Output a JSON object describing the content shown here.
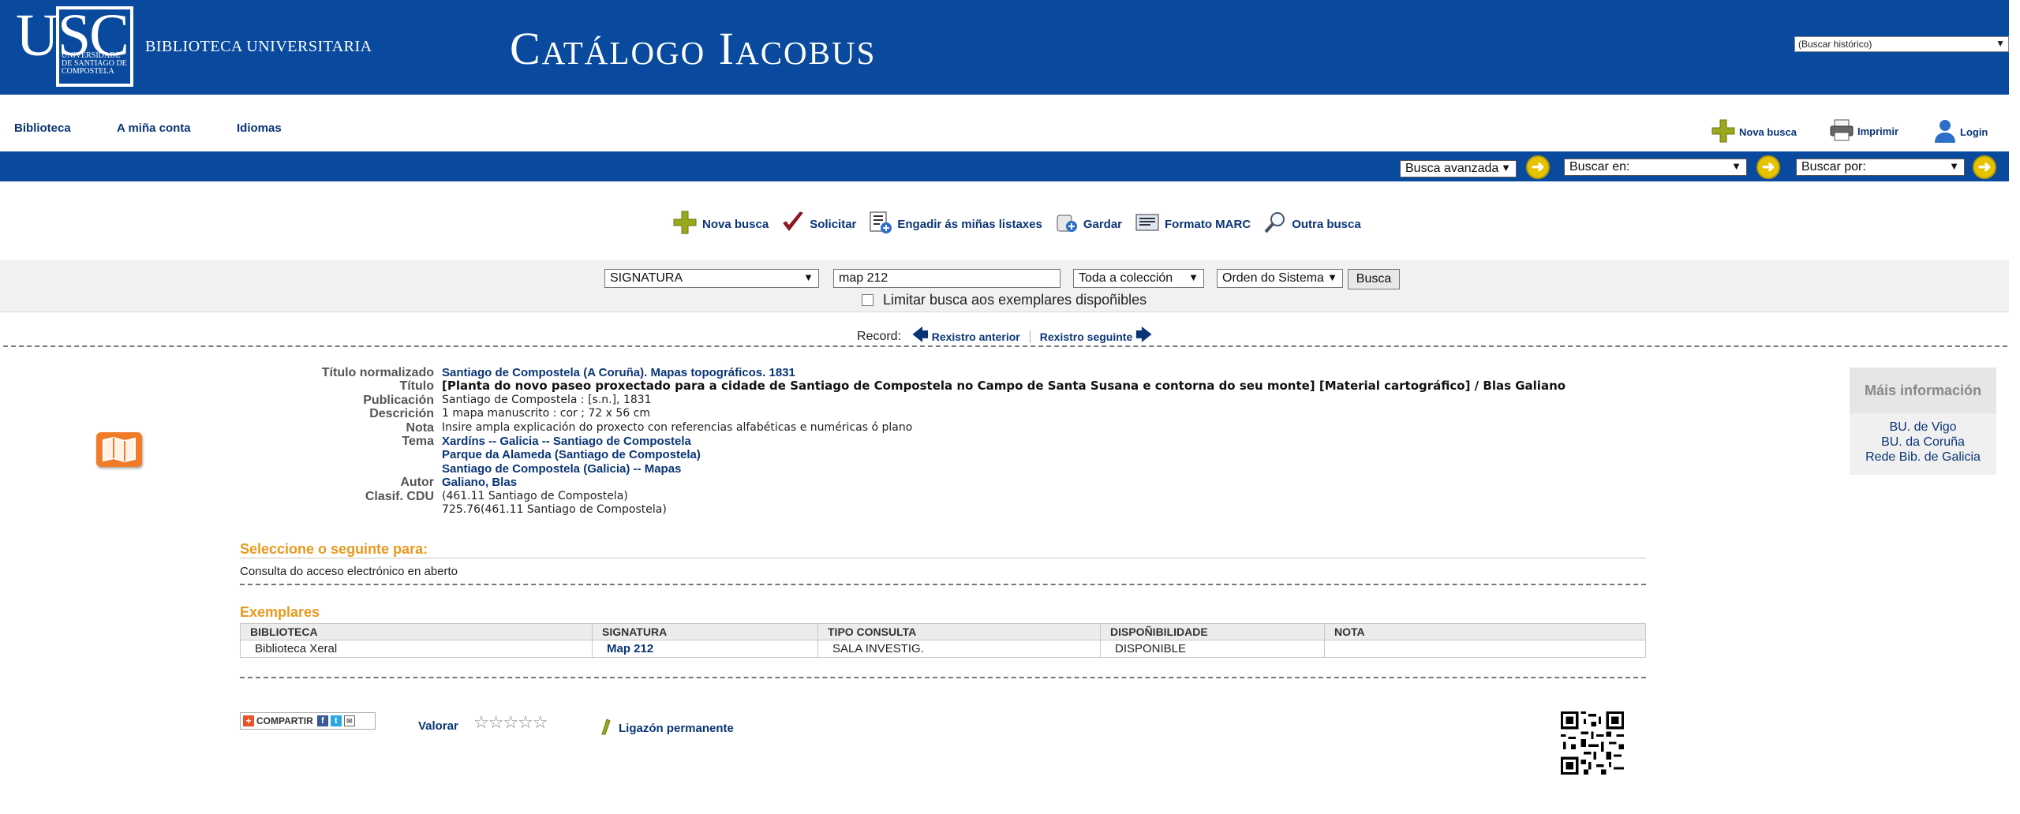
{
  "header": {
    "logo_letters": "USC",
    "logo_sub": "Universidade de Santiago de Compostela",
    "library_name": "BIBLIOTECA UNIVERSITARIA",
    "catalog_title": "Catálogo Iacobus",
    "history_select": "(Buscar histórico)"
  },
  "topnav": {
    "items": [
      "Biblioteca",
      "A miña conta",
      "Idiomas"
    ],
    "new_search": "Nova busca",
    "print": "Imprimir",
    "login": "Login"
  },
  "bluebar": {
    "advanced": "Busca avanzada",
    "search_in": "Buscar en:",
    "search_by": "Buscar por:"
  },
  "actions": {
    "new_search": "Nova busca",
    "request": "Solicitar",
    "add_list": "Engadir ás miñas listaxes",
    "save": "Gardar",
    "marc": "Formato MARC",
    "other": "Outra busca"
  },
  "search": {
    "field": "SIGNATURA",
    "query": "map 212",
    "collection": "Toda a colección",
    "order": "Orden do Sistema",
    "button": "Busca",
    "limit_label": "Limitar busca aos exemplares dispoñibles"
  },
  "record_nav": {
    "label": "Record:",
    "prev": "Rexistro anterior",
    "next": "Rexistro seguinte"
  },
  "record": {
    "titulo_normalizado_label": "Título normalizado",
    "titulo_normalizado": "Santiago de Compostela (A Coruña). Mapas topográficos. 1831",
    "titulo_label": "Título",
    "titulo": "[Planta do novo paseo proxectado para a cidade de Santiago de Compostela no Campo de Santa Susana e contorna do seu monte] [Material cartográfico] / Blas Galiano",
    "publicacion_label": "Publicación",
    "publicacion": "Santiago de Compostela : [s.n.], 1831",
    "descricion_label": "Descrición",
    "descricion": "1 mapa manuscrito : cor ; 72 x 56 cm",
    "nota_label": "Nota",
    "nota": "Insire ampla explicación do proxecto con referencias alfabéticas e numéricas ó plano",
    "tema_label": "Tema",
    "tema": [
      "Xardíns -- Galicia -- Santiago de Compostela",
      "Parque da Alameda (Santiago de Compostela)",
      "Santiago de Compostela (Galicia) -- Mapas"
    ],
    "autor_label": "Autor",
    "autor": "Galiano, Blas",
    "clasif_label": "Clasif. CDU",
    "clasif": [
      "(461.11 Santiago de Compostela)",
      "725.76(461.11 Santiago de Compostela)"
    ]
  },
  "mais_info": {
    "title": "Máis información",
    "links": [
      "BU. de Vigo",
      "BU. da Coruña",
      "Rede Bib. de Galicia"
    ]
  },
  "select_section": {
    "title": "Seleccione o seguinte para:",
    "link": "Consulta do acceso electrónico en aberto"
  },
  "exemplares": {
    "title": "Exemplares",
    "headers": [
      "BIBLIOTECA",
      "SIGNATURA",
      "TIPO CONSULTA",
      "DISPOÑIBILIDADE",
      "NOTA"
    ],
    "rows": [
      [
        "Biblioteca Xeral",
        "Map 212",
        "SALA INVESTIG.",
        "DISPONIBLE",
        ""
      ]
    ]
  },
  "footer": {
    "share": "COMPARTIR",
    "rate": "Valorar",
    "stars": "☆☆☆☆☆",
    "permalink": "Ligazón permanente"
  }
}
